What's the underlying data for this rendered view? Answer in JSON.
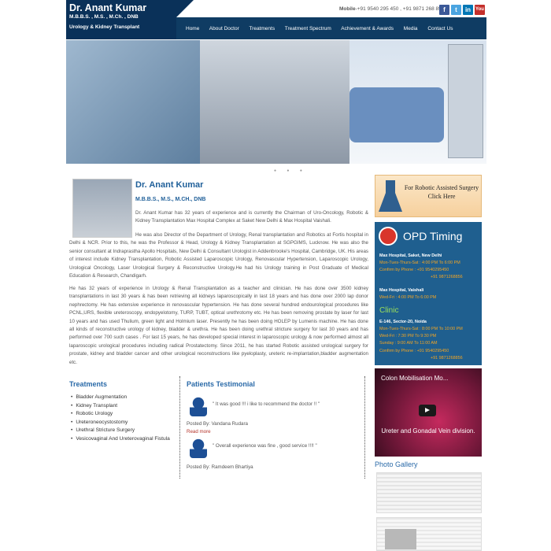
{
  "header": {
    "name": "Dr. Anant Kumar",
    "degrees": "M.B.B.S. , M.S. , M.Ch. , DNB",
    "specialty": "Urology & Kidney Transplant",
    "mobile_label": "Mobile",
    "mobile_numbers": "+91 9540 295 450 , +91 9871 268 856",
    "social": [
      "facebook-icon",
      "twitter-icon",
      "linkedin-icon",
      "youtube-icon"
    ],
    "nav": [
      "Home",
      "About Doctor",
      "Treatments",
      "Treatment Spectrum",
      "Achievement & Awards",
      "Media",
      "Contact Us"
    ]
  },
  "doctor": {
    "name": "Dr. Anant Kumar",
    "degrees": "M.B.B.S., M.S., M.CH., DNB",
    "para1": "Dr. Anant Kumar has 32 years of experience and is currently the Chairman of Uro-Oncology, Robotic & Kidney Transplantation Max Hospital Complex at Saket New Delhi & Max Hospital Vaishali.",
    "para2": "He was also Director of the Department of Urology, Renal transplantation and Robotics at Fortis hospital in Delhi & NCR. Prior to this, he was the Professor & Head, Urology & Kidney Transplantation at SGPGIMS, Lucknow. He was also the senior consultant at Indraprastha Apollo Hospitals, New Delhi & Consultant Urologist in Addenbrooke's Hospital, Cambridge, UK. His areas of interest include Kidney Transplantation, Robotic Assisted Laparoscopic Urology, Renovascular Hypertension, Laparoscopic Urology, Urological Oncology, Laser Urological Surgery & Reconstructive Urology.He had his Urology training in Post Graduate of Medical Education & Research, Chandigarh.",
    "para3": "He has 32 years of experience in Urology & Renal Transplantation as a teacher and clinician. He has done over 3500 kidney transplantations in last 30 years & has been retrieving all kidneys laparoscopically in last 18 years and has done over 2000 lap donor nephrectomy. He has extensive experience in renovascular hypertension. He has done several hundred endourological procedures like PCNL,URS, flexible ureteroscopy, endopyelotomy, TURP, TUBT, optical urethrotomy etc. He has been removing prostate by laser for last 10 years and has used Thulium, green light and Holmium laser. Presently he has been doing HOLEP by Lumenis machine. He has done all kinds of reconstructive urology of kidney, bladder & urethra. He has been doing urethral stricture surgery for last 30 years and has performed over 700 such cases . For last 15 years, he has developed special interest in laparoscopic urology & now performed almost all laparoscopic urological procedures including radical Prostatectomy. Since 2011, he has started Robotic assisted urological surgery for prostate, kidney and bladder cancer and other urological reconstructions like pyeloplasty, ureteric re-implantation,bladder augmentation etc."
  },
  "treatments": {
    "title": "Treatments",
    "items": [
      "Bladder Augmentation",
      "Kidney Transplant",
      "Robotic Urology",
      "Ureteroneocystostomy",
      "Urethral Stricture Surgery",
      "Vesicovaginal And Ureterovaginal Fistula"
    ]
  },
  "testimonials": {
    "title": "Patients Testimonial",
    "items": [
      {
        "quote": "\" It was good !!! i like to recommend the doctor !! \"",
        "posted": "Posted By: Vandana Rudara"
      },
      {
        "quote": "\" Overall experience was fine , good service !!!! \"",
        "posted": "Posted By: Ramdeem Bhartiya"
      }
    ],
    "read_more": "Read more"
  },
  "sidebar": {
    "promo": "For Robotic Assisted Surgery Click Here",
    "opd_title": "OPD Timing",
    "opd": [
      {
        "text": "Max Hospital, Saket, New Delhi",
        "color": "#ffffff",
        "bold": true
      },
      {
        "text": "Mon-Tues-Thurs-Sat : 4:00 PM To 6:00 PM",
        "color": "#f5a623"
      },
      {
        "text": "Confirm by Phone : +91 9540295450",
        "color": "#f5a623"
      },
      {
        "text": "+91 9871268856",
        "color": "#f5a623"
      },
      {
        "text": "Max Hospital, Vaishali",
        "color": "#ffffff",
        "bold": true
      },
      {
        "text": "Wed-Fri : 4:00 PM To 6:00 PM",
        "color": "#f5a623"
      },
      {
        "text": "E-146, Sector-20, Noida",
        "color": "#ffffff",
        "bold": true
      },
      {
        "text": "Mon-Tues-Thurs-Sat : 8:00 PM To 10:00 PM",
        "color": "#f5a623"
      },
      {
        "text": "Wed-Fri : 7:30 PM To 9:30 PM",
        "color": "#f5a623"
      },
      {
        "text": "Sunday : 9:00 AM To 11:00 AM",
        "color": "#f5a623"
      },
      {
        "text": "Confirm by Phone : +91 9540295450",
        "color": "#f5a623"
      },
      {
        "text": "+91 9871268856",
        "color": "#f5a623"
      }
    ],
    "clinic_label": "Clinic",
    "video_title": "Colon Mobilisation Mo...",
    "video_caption": "Ureter and Gonadal Vein division.",
    "gallery_title": "Photo Gallery"
  },
  "colors": {
    "brand": "#0f3c63",
    "accent": "#2a6aa8",
    "opd_bg": "#1f5f8f",
    "time_orange": "#f5a623",
    "clinic_green": "#9be05a"
  }
}
